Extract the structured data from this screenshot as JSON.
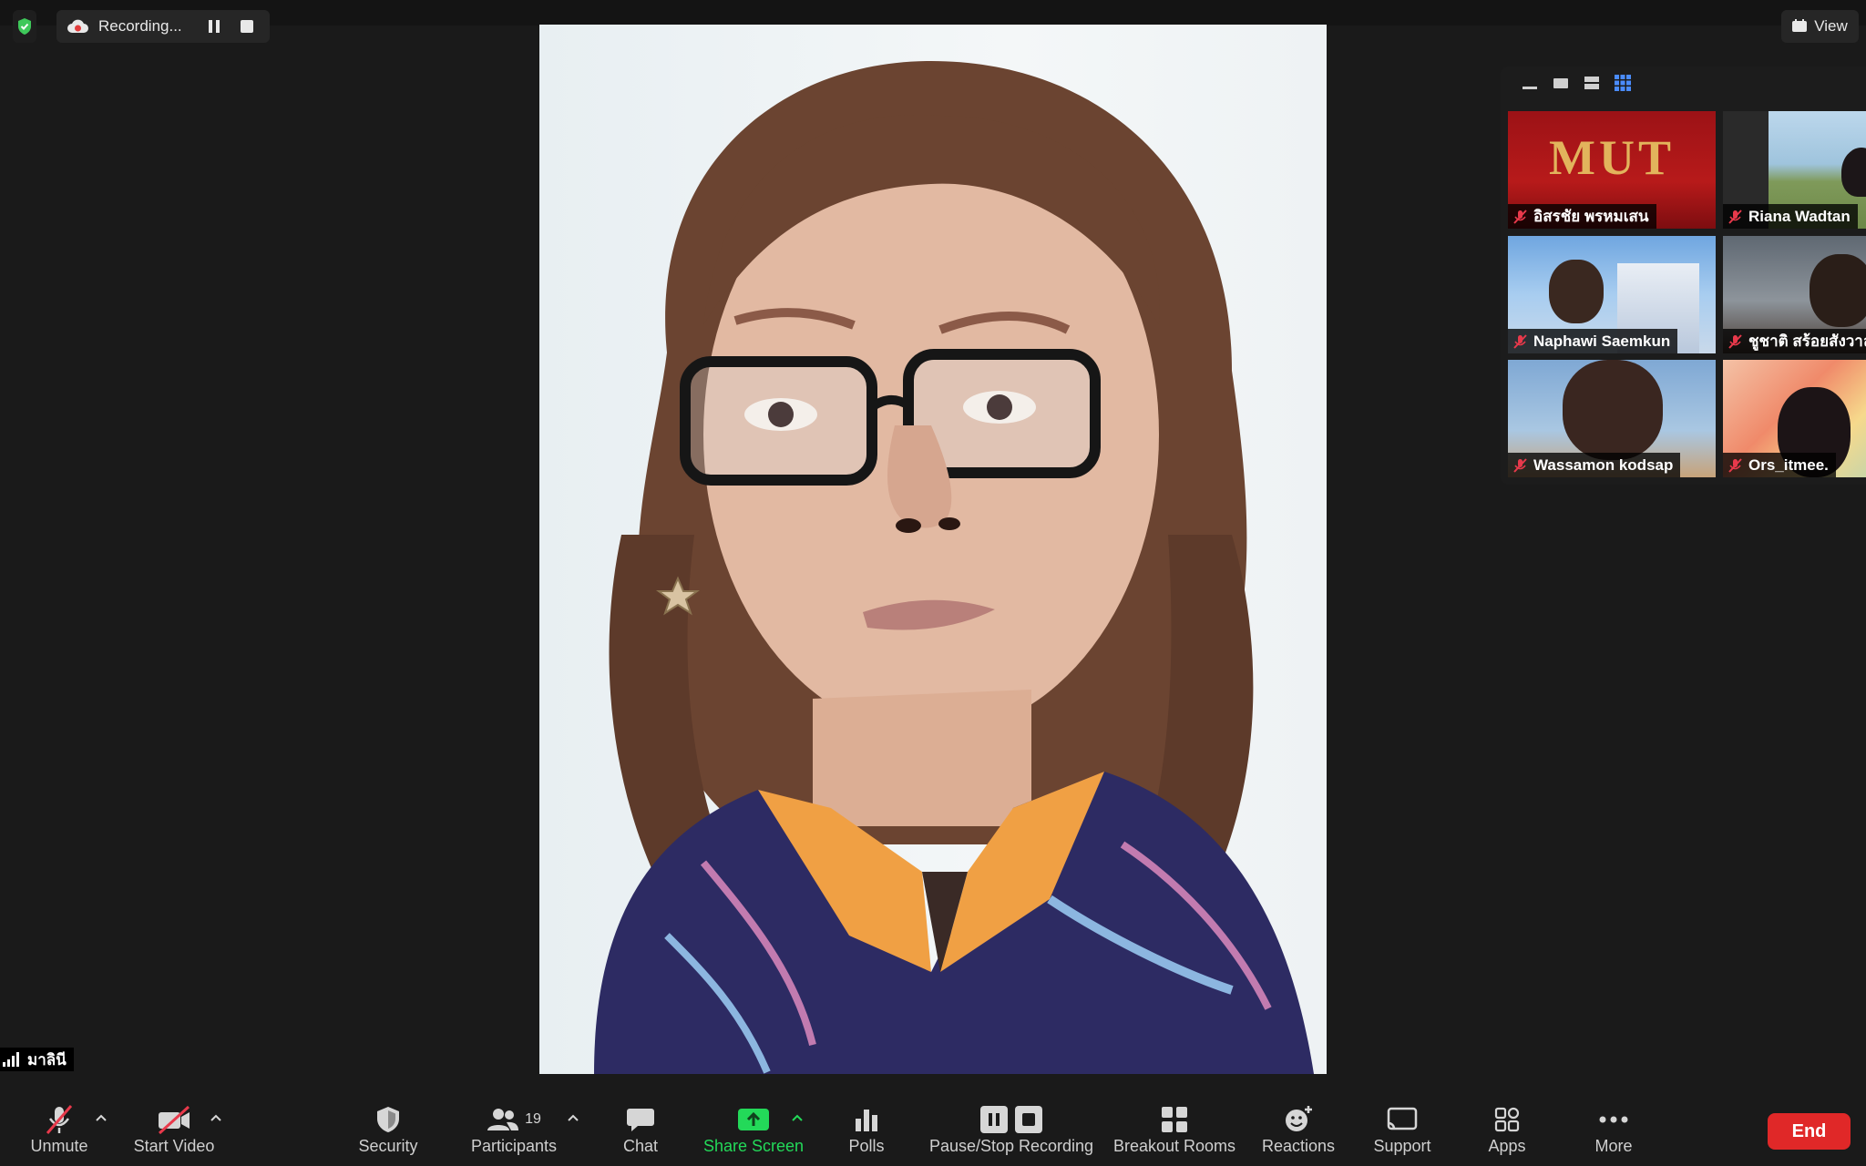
{
  "recording": {
    "status": "Recording..."
  },
  "view": {
    "label": "View"
  },
  "gallery": {
    "tiles": [
      {
        "name": "อิสรชัย พรหมเสน",
        "muted": true
      },
      {
        "name": "Riana Wadtan",
        "muted": true
      },
      {
        "name": "Naphawi Saemkun",
        "muted": true
      },
      {
        "name": "ชูชาติ สร้อยสังวาล",
        "muted": true
      },
      {
        "name": "Wassamon kodsap",
        "muted": true
      },
      {
        "name": "Ors_itmee.",
        "muted": true
      }
    ],
    "first_tile_logo": "MUT"
  },
  "speaker": {
    "name": "มาลินี"
  },
  "toolbar": {
    "unmute": "Unmute",
    "start_video": "Start Video",
    "security": "Security",
    "participants": "Participants",
    "participants_count": "19",
    "chat": "Chat",
    "share_screen": "Share Screen",
    "polls": "Polls",
    "pause_stop_recording": "Pause/Stop Recording",
    "breakout_rooms": "Breakout Rooms",
    "reactions": "Reactions",
    "support": "Support",
    "apps": "Apps",
    "more": "More",
    "end": "End"
  },
  "colors": {
    "share_green": "#23d959",
    "end_red": "#e02828",
    "muted_red": "#e8394b",
    "active_blue": "#4a8cff"
  }
}
